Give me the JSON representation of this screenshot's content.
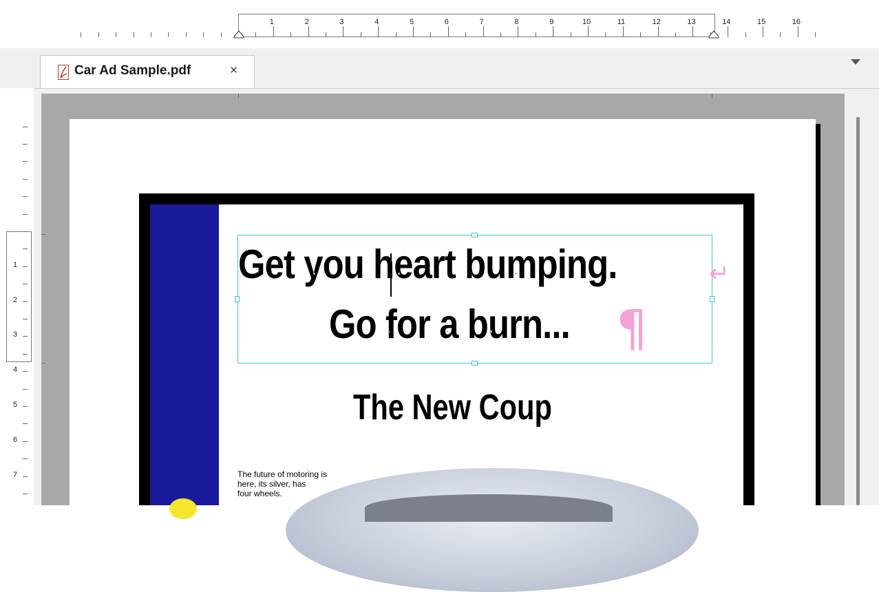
{
  "ruler": {
    "top_labels": [
      "1",
      "2",
      "3",
      "4",
      "5",
      "6",
      "7",
      "8",
      "9",
      "10",
      "11",
      "12",
      "13",
      "14",
      "15",
      "16"
    ],
    "left_labels": [
      "1",
      "2",
      "3",
      "4",
      "5",
      "6",
      "7"
    ]
  },
  "tab": {
    "title": "Car Ad Sample.pdf",
    "close_glyph": "×",
    "icon": "pdf-icon"
  },
  "document": {
    "headline_line1": "Get you heart bumping.",
    "headline_line2": "Go for a burn...",
    "subhead": "The New Coup",
    "body_lines": [
      "The future of motoring is",
      "here, its silver, has",
      "four wheels."
    ],
    "paragraph_mark": "¶",
    "line_break_mark": "↵"
  },
  "colors": {
    "selection_frame": "#40c4d4",
    "formatting_marks": "#f4a3d6",
    "band": "#1a1a9c",
    "accent_yellow": "#f5e52d"
  }
}
